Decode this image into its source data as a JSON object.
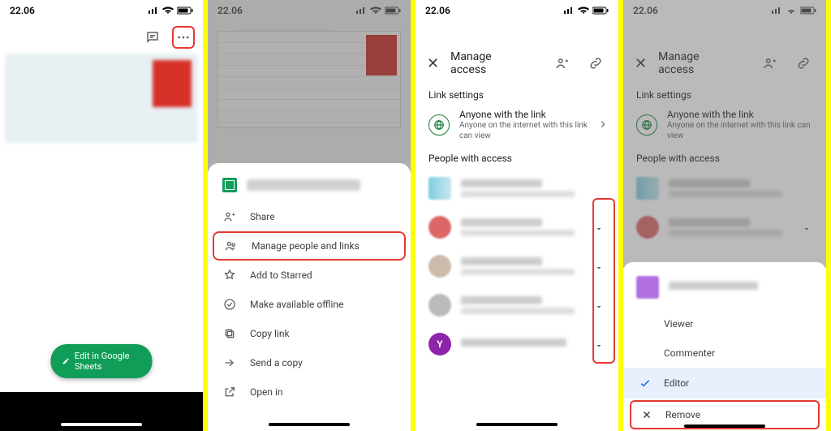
{
  "status": {
    "time": "22.06"
  },
  "screen1": {
    "fab_label": "Edit in Google Sheets"
  },
  "screen2": {
    "menu": {
      "share": "Share",
      "manage": "Manage people and links",
      "star": "Add to Starred",
      "offline": "Make available offline",
      "copylink": "Copy link",
      "sendcopy": "Send a copy",
      "openin": "Open in"
    }
  },
  "manage": {
    "title": "Manage access",
    "link_section": "Link settings",
    "link_title": "Anyone with the link",
    "link_sub": "Anyone on the internet with this link can view",
    "people_section": "People with access",
    "avatar_letter": "Y"
  },
  "roles": {
    "viewer": "Viewer",
    "commenter": "Commenter",
    "editor": "Editor",
    "remove": "Remove"
  }
}
